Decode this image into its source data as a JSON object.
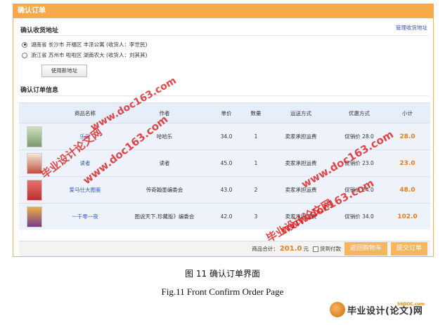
{
  "panel_title": "确认订单",
  "shipping": {
    "title": "确认收货地址",
    "manage_link": "管理收货地址",
    "addresses": [
      {
        "text": "湖南省 长沙市 开福区 丰泽公寓 (收货人：李世民)",
        "selected": true
      },
      {
        "text": "浙江省 苏州市 啦啦区 湖南农大 (收货人：刘其其)",
        "selected": false
      }
    ],
    "new_address_button": "使用新地址"
  },
  "order": {
    "title": "确认订单信息",
    "headers": [
      "商品名称",
      "作者",
      "单价",
      "数量",
      "运送方式",
      "优惠方式",
      "小计"
    ],
    "rows": [
      {
        "name": "乐乐",
        "author": "哈哈乐",
        "price": "34.0",
        "qty": "1",
        "shipping": "卖家承担运费",
        "discount": "促销价 28.0",
        "subtotal": "28.0",
        "thumb_color": "#7a9a6a"
      },
      {
        "name": "读者",
        "author": "读者",
        "price": "45.0",
        "qty": "1",
        "shipping": "卖家承担运费",
        "discount": "促销价 23.0",
        "subtotal": "23.0",
        "thumb_color": "#c05040"
      },
      {
        "name": "爱马仕大图鉴",
        "author": "传奇翰墨编委会",
        "price": "43.0",
        "qty": "2",
        "shipping": "卖家承担运费",
        "discount": "促销价 24.0",
        "subtotal": "48.0",
        "thumb_color": "#b83030"
      },
      {
        "name": "一千零一夜",
        "author": "图说天下.珍藏版》编委会",
        "price": "42.0",
        "qty": "3",
        "shipping": "卖家承担运费",
        "discount": "促销价 34.0",
        "subtotal": "102.0",
        "thumb_color": "#7a3a8a"
      }
    ]
  },
  "footer": {
    "total_label": "商品合计：",
    "total_value": "201.0",
    "currency": "元",
    "cod_label": "货到付款",
    "back_button": "返回购物车",
    "submit_button": "提交订单"
  },
  "watermarks": [
    "www.doc163.com",
    "毕业设计论文网"
  ],
  "caption_zh": "图 11  确认订单界面",
  "caption_en": "Fig.11 Front Confirm Order Page",
  "logo": {
    "top_text": "56DOC.com",
    "text": "毕业设计(论文)网"
  },
  "colors": {
    "header_orange": "#f7a94a",
    "accent_orange": "#f07a1a",
    "link_blue": "#3355cc",
    "watermark_red": "#dc1414"
  }
}
